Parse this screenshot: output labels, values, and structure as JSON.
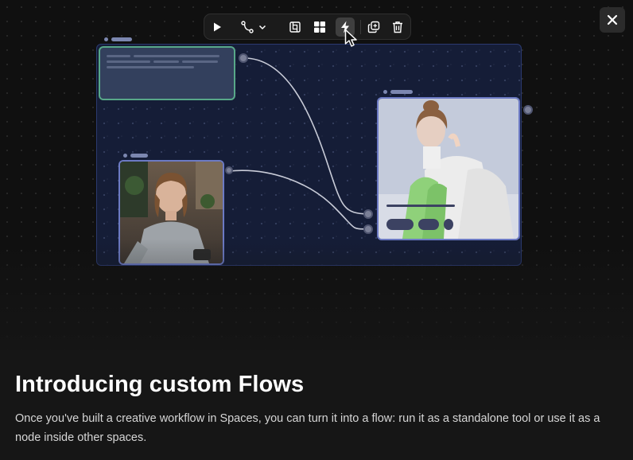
{
  "dialog": {
    "close_icon": "close-icon",
    "heading": "Introducing custom Flows",
    "description": "Once you've built a creative workflow in Spaces, you can turn it into a flow: run it as a standalone tool or use it as a node inside other spaces."
  },
  "toolbar": {
    "icons": [
      "play-icon",
      "connector-icon",
      "chevron-down-icon",
      "frame-icon",
      "grid-icon",
      "lightning-icon",
      "duplicate-icon",
      "trash-icon"
    ],
    "active": "lightning-icon"
  },
  "canvas": {
    "nodes": [
      "text-node",
      "image-node-selfie",
      "image-node-portrait"
    ]
  },
  "colors": {
    "background": "#161616",
    "panel": "#18224a",
    "text_node_border": "#58a889",
    "image_border": "#6c7ac4"
  }
}
